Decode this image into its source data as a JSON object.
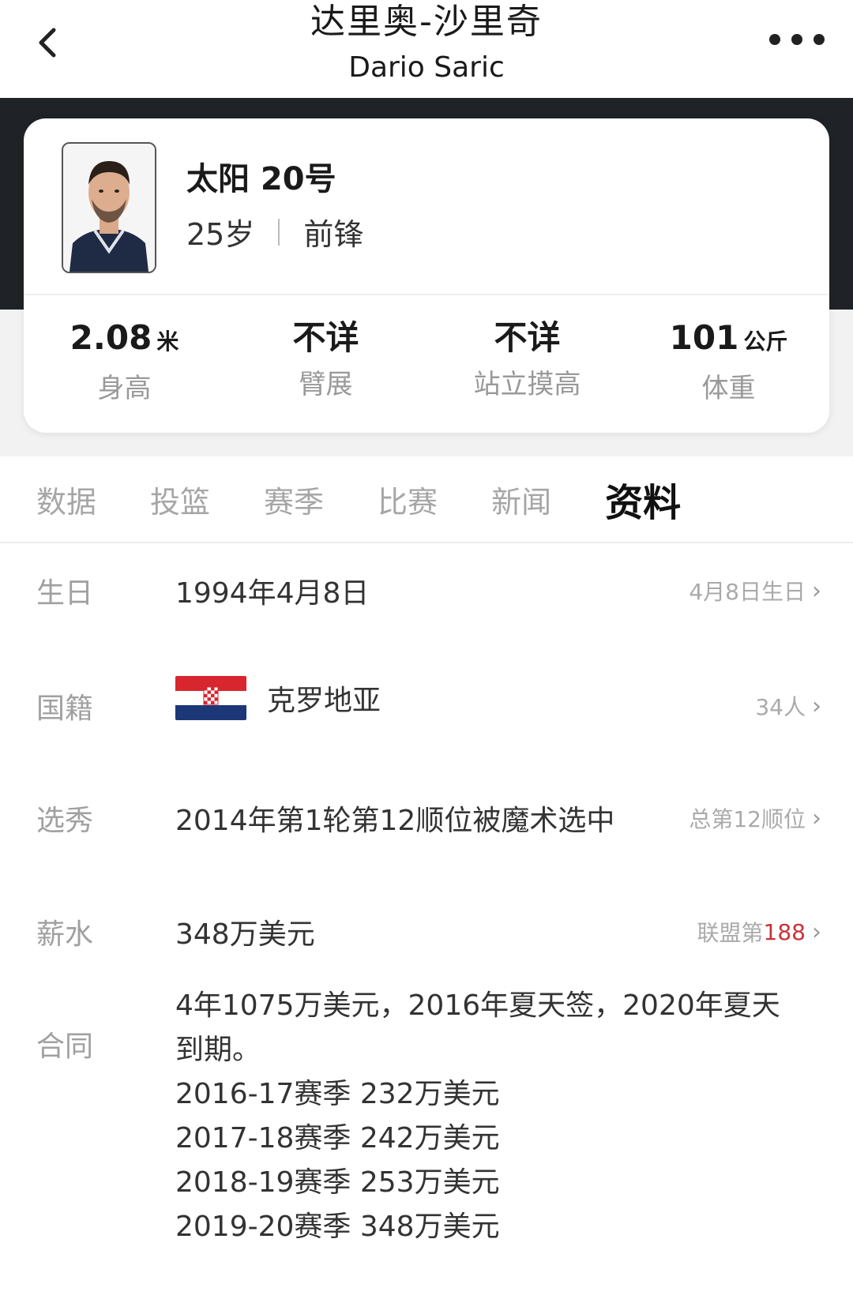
{
  "header": {
    "title": "达里奥-沙里奇",
    "subtitle": "Dario Saric"
  },
  "player": {
    "team_number": "太阳 20号",
    "age": "25岁",
    "position": "前锋",
    "stats": [
      {
        "value": "2.08",
        "unit": "米",
        "label": "身高"
      },
      {
        "value": "不详",
        "unit": "",
        "label": "臂展"
      },
      {
        "value": "不详",
        "unit": "",
        "label": "站立摸高"
      },
      {
        "value": "101",
        "unit": "公斤",
        "label": "体重"
      }
    ]
  },
  "tabs": [
    "数据",
    "投篮",
    "赛季",
    "比赛",
    "新闻",
    "资料"
  ],
  "active_tab": "资料",
  "info": {
    "birthday": {
      "label": "生日",
      "value": "1994年4月8日",
      "link": "4月8日生日"
    },
    "nationality": {
      "label": "国籍",
      "value": "克罗地亚",
      "link": "34人"
    },
    "draft": {
      "label": "选秀",
      "value": "2014年第1轮第12顺位被魔术选中",
      "link": "总第12顺位"
    },
    "salary": {
      "label": "薪水",
      "value": "348万美元",
      "link_prefix": "联盟第",
      "link_rank": "188"
    },
    "contract": {
      "label": "合同",
      "lines": [
        "4年1075万美元，2016年夏天签，2020年夏天",
        "到期。",
        "2016-17赛季 232万美元",
        "2017-18赛季 242万美元",
        "2018-19赛季 253万美元",
        "2019-20赛季 348万美元"
      ]
    }
  },
  "colors": {
    "dark_band": "#1f2327",
    "accent_rank": "#c8323a",
    "label_grey": "#a0a0a0"
  },
  "icons": [
    "chevron-left-icon",
    "more-dots-icon",
    "chevron-right-icon",
    "croatia-flag-icon"
  ]
}
